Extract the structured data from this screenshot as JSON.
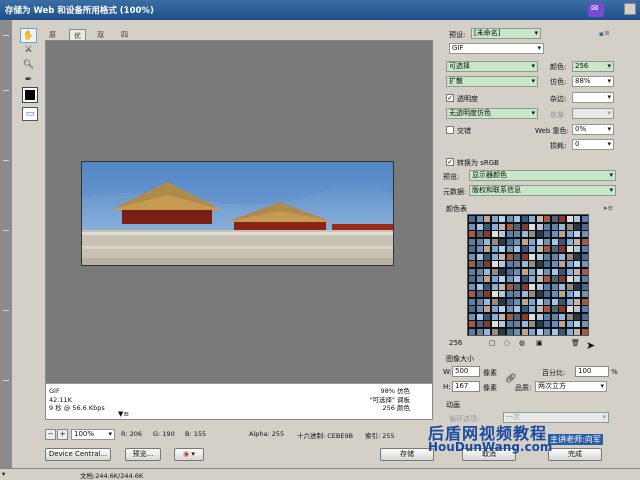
{
  "window": {
    "title": "存储为 Web 和设备所用格式 (100%)"
  },
  "tabs": [
    {
      "label": "原稿",
      "active": false
    },
    {
      "label": "优化",
      "active": true
    },
    {
      "label": "双联",
      "active": false
    },
    {
      "label": "四联",
      "active": false
    }
  ],
  "info": {
    "format": "GIF",
    "size": "42.11K",
    "time": "9 秒 @ 56.6 Kbps",
    "time_menu": "▼≡",
    "dither_line": "98% 仿色",
    "palette_line": "\"可选择\" 调板",
    "colors_line": "256 颜色"
  },
  "settings": {
    "preset_label": "预设:",
    "preset_value": "[未命名]",
    "format_value": "GIF",
    "reduction_value": "可选择",
    "colors_label": "颜色:",
    "colors_value": "256",
    "dither_algo_value": "扩散",
    "dither_label": "仿色:",
    "dither_value": "88%",
    "transparency_label": "透明度",
    "transparency_checked": true,
    "matte_label": "杂边:",
    "transparency_dither_value": "无透明度仿色",
    "amount_label": "数量:",
    "interlaced_label": "交错",
    "interlaced_checked": false,
    "web_snap_label": "Web 靠色:",
    "web_snap_value": "0%",
    "lossy_label": "损耗:",
    "lossy_value": "0",
    "convert_srgb_label": "转换为 sRGB",
    "convert_srgb_checked": true,
    "preview_label": "预览:",
    "preview_value": "显示器颜色",
    "metadata_label": "元数据:",
    "metadata_value": "版权和联系信息"
  },
  "color_table": {
    "title": "颜色表",
    "count": "256",
    "colors": [
      "#4f6a8a",
      "#7fa6cf",
      "#a4c4e4",
      "#c9b7a6",
      "#8a3a2a",
      "#5d7da4",
      "#9a8a7a",
      "#6b8fbb",
      "#b8d0ea",
      "#3e5676",
      "#a35a45",
      "#e0e0d8",
      "#6f8398",
      "#2a3848",
      "#c4a484",
      "#7690ad",
      "#8aaed8",
      "#506478",
      "#b9c6d4",
      "#98b8da"
    ]
  },
  "image_size": {
    "title": "图像大小",
    "w_label": "W:",
    "w_value": "500",
    "h_label": "H:",
    "h_value": "167",
    "unit": "像素",
    "percent_label": "百分比:",
    "percent_value": "100",
    "percent_unit": "%",
    "quality_label": "品质:",
    "quality_value": "两次立方"
  },
  "animation": {
    "title": "动画",
    "loop_label": "循环选项:",
    "loop_value": "一次"
  },
  "bottom": {
    "zoom": "100%",
    "r": "R: 206",
    "g": "G: 190",
    "b": "B: 155",
    "alpha": "Alpha: 255",
    "hex": "十六进制: CEBE9B",
    "index": "索引: 255"
  },
  "buttons": {
    "device_central": "Device Central...",
    "preview": "预览...",
    "save": "存储",
    "cancel": "取消",
    "done": "完成"
  },
  "status": {
    "doc": "文档:244.6K/244.6K"
  },
  "watermark": {
    "line1": "后盾网视频教程",
    "line2": "HouDunWang.com",
    "line3": "主讲老师:向军"
  }
}
